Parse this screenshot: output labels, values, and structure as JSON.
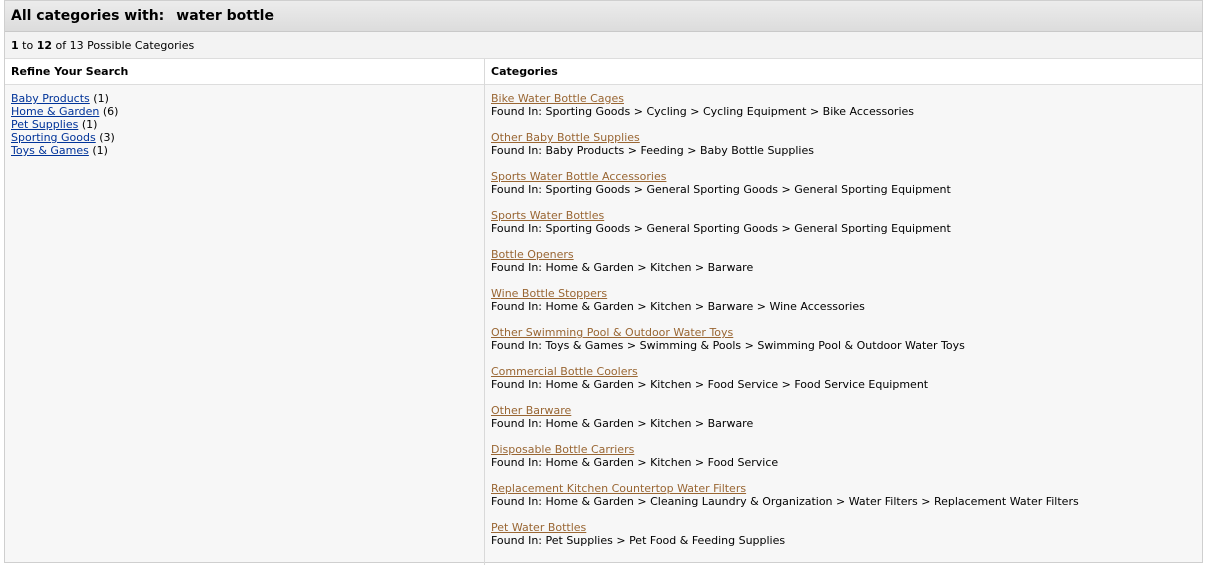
{
  "header": {
    "label": "All categories with:",
    "query": "water bottle"
  },
  "count": {
    "start": "1",
    "to": "to",
    "end": "12",
    "rest": "of 13 Possible Categories"
  },
  "refine": {
    "title": "Refine Your Search",
    "items": [
      {
        "label": "Baby Products",
        "count": "(1)"
      },
      {
        "label": "Home & Garden",
        "count": "(6)"
      },
      {
        "label": "Pet Supplies",
        "count": "(1)"
      },
      {
        "label": "Sporting Goods",
        "count": "(3)"
      },
      {
        "label": "Toys & Games",
        "count": "(1)"
      }
    ]
  },
  "categories": {
    "title": "Categories",
    "items": [
      {
        "name": "Bike Water Bottle Cages",
        "path": "Found In: Sporting Goods > Cycling > Cycling Equipment > Bike Accessories"
      },
      {
        "name": "Other Baby Bottle Supplies",
        "path": "Found In: Baby Products > Feeding > Baby Bottle Supplies"
      },
      {
        "name": "Sports Water Bottle Accessories",
        "path": "Found In: Sporting Goods > General Sporting Goods > General Sporting Equipment"
      },
      {
        "name": "Sports Water Bottles",
        "path": "Found In: Sporting Goods > General Sporting Goods > General Sporting Equipment"
      },
      {
        "name": "Bottle Openers",
        "path": "Found In: Home & Garden > Kitchen > Barware"
      },
      {
        "name": "Wine Bottle Stoppers",
        "path": "Found In: Home & Garden > Kitchen > Barware > Wine Accessories"
      },
      {
        "name": "Other Swimming Pool & Outdoor Water Toys",
        "path": "Found In: Toys & Games > Swimming & Pools > Swimming Pool & Outdoor Water Toys"
      },
      {
        "name": "Commercial Bottle Coolers",
        "path": "Found In: Home & Garden > Kitchen > Food Service > Food Service Equipment"
      },
      {
        "name": "Other Barware",
        "path": "Found In: Home & Garden > Kitchen > Barware"
      },
      {
        "name": "Disposable Bottle Carriers",
        "path": "Found In: Home & Garden > Kitchen > Food Service"
      },
      {
        "name": "Replacement Kitchen Countertop Water Filters",
        "path": "Found In: Home & Garden > Cleaning Laundry & Organization > Water Filters > Replacement Water Filters"
      },
      {
        "name": "Pet Water Bottles",
        "path": "Found In: Pet Supplies > Pet Food & Feeding Supplies"
      }
    ]
  },
  "colors": {
    "refine_link": "#003399",
    "category_link": "#996633",
    "header_bg": "#e3e3e3"
  }
}
